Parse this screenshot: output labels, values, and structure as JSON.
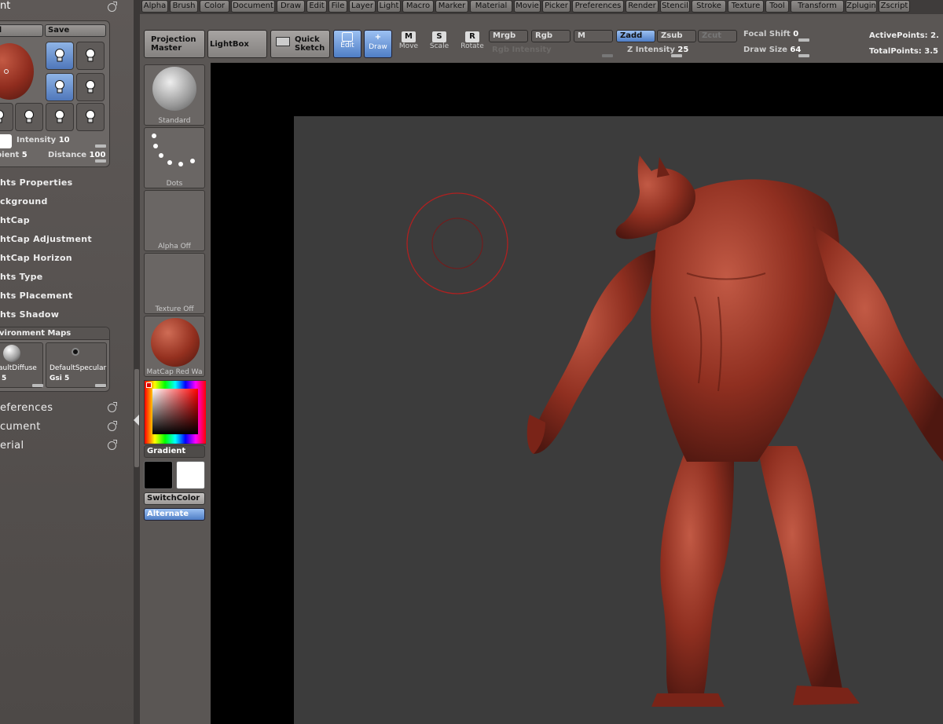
{
  "left_panel": {
    "title": "nt",
    "light_box": {
      "load_label": "d",
      "save_label": "Save",
      "intensity_label": "Intensity",
      "intensity_value": "10",
      "ambient_label": "bient",
      "ambient_value": "5",
      "distance_label": "Distance",
      "distance_value": "100"
    },
    "subitems": [
      "hts Properties",
      "ckground",
      "htCap",
      "htCap Adjustment",
      "htCap Horizon",
      "hts Type",
      "hts Placement",
      "hts Shadow"
    ],
    "environment_maps": {
      "title": "vironment Maps",
      "diffuse_label": "aultDiffuse",
      "diffuse_value": "5",
      "specular_label": "DefaultSpecular",
      "gsi_label": "Gsi",
      "gsi_value": "5"
    },
    "menus": [
      "eferences",
      "cument",
      "erial"
    ]
  },
  "top_menu": [
    "Alpha",
    "Brush",
    "Color",
    "Document",
    "Draw",
    "Edit",
    "File",
    "Layer",
    "Light",
    "Macro",
    "Marker",
    "Material",
    "Movie",
    "Picker",
    "Preferences",
    "Render",
    "Stencil",
    "Stroke",
    "Texture",
    "Tool",
    "Transform",
    "Zplugin",
    "Zscript"
  ],
  "toolbar": {
    "projection_master": [
      "Projection",
      "Master"
    ],
    "lightbox": "LightBox",
    "quick_sketch": [
      "Quick",
      "Sketch"
    ],
    "modes": {
      "edit": "Edit",
      "draw": "Draw",
      "move": "Move",
      "move_glyph": "M",
      "scale": "Scale",
      "scale_glyph": "S",
      "rotate": "Rotate",
      "rotate_glyph": "R"
    },
    "mrgb": "Mrgb",
    "rgb": "Rgb",
    "m": "M",
    "zadd": "Zadd",
    "zsub": "Zsub",
    "zcut": "Zcut",
    "rgb_intensity_label": "Rgb Intensity",
    "z_intensity_label": "Z Intensity",
    "z_intensity_value": "25",
    "focal_shift_label": "Focal Shift",
    "focal_shift_value": "0",
    "draw_size_label": "Draw Size",
    "draw_size_value": "64",
    "active_points": "ActivePoints: 2.",
    "total_points": "TotalPoints: 3.5"
  },
  "tool_strip": {
    "brush": "Standard",
    "stroke": "Dots",
    "alpha": "Alpha Off",
    "texture": "Texture Off",
    "material": "MatCap Red Wa",
    "gradient": "Gradient",
    "switch_color": "SwitchColor",
    "alternate": "Alternate"
  },
  "colors": {
    "accent": "#4f7ec6",
    "model": "#9a3a2a",
    "canvas": "#3c3c3c"
  }
}
